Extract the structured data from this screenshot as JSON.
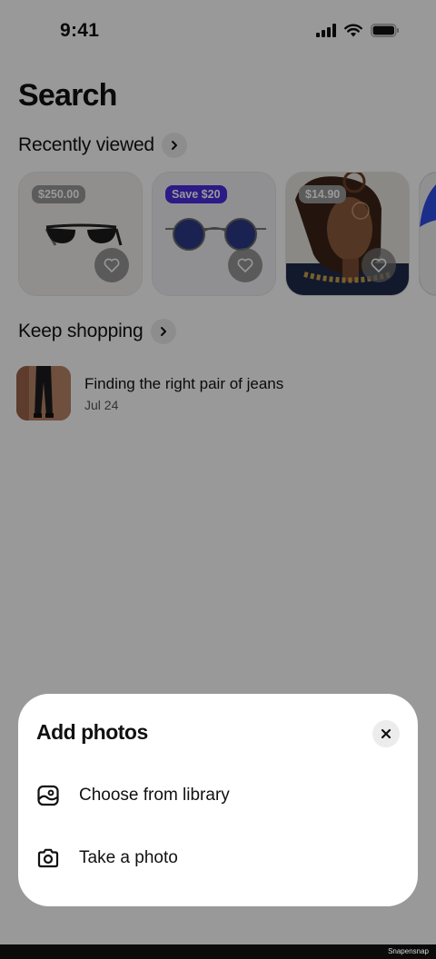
{
  "status_bar": {
    "time": "9:41"
  },
  "page": {
    "title": "Search"
  },
  "recently_viewed": {
    "title": "Recently viewed",
    "items": [
      {
        "badge": "$250.00",
        "image": "black-sunglasses"
      },
      {
        "badge": "Save $20",
        "image": "round-blue-sunglasses"
      },
      {
        "badge": "$14.90",
        "image": "woman-with-glasses"
      }
    ]
  },
  "keep_shopping": {
    "title": "Keep shopping",
    "items": [
      {
        "title": "Finding the right pair of jeans",
        "date": "Jul 24",
        "image": "jeans-photo"
      }
    ]
  },
  "sheet": {
    "title": "Add photos",
    "options": [
      {
        "label": "Choose from library",
        "icon": "photo-library-icon"
      },
      {
        "label": "Take a photo",
        "icon": "camera-icon"
      }
    ]
  },
  "footer": {
    "watermark": "Snapensnap"
  },
  "colors": {
    "sale_badge": "#4a2ce0",
    "accent_peek": "#2d4ee6",
    "overlay": "rgba(0,0,0,0.40)"
  }
}
